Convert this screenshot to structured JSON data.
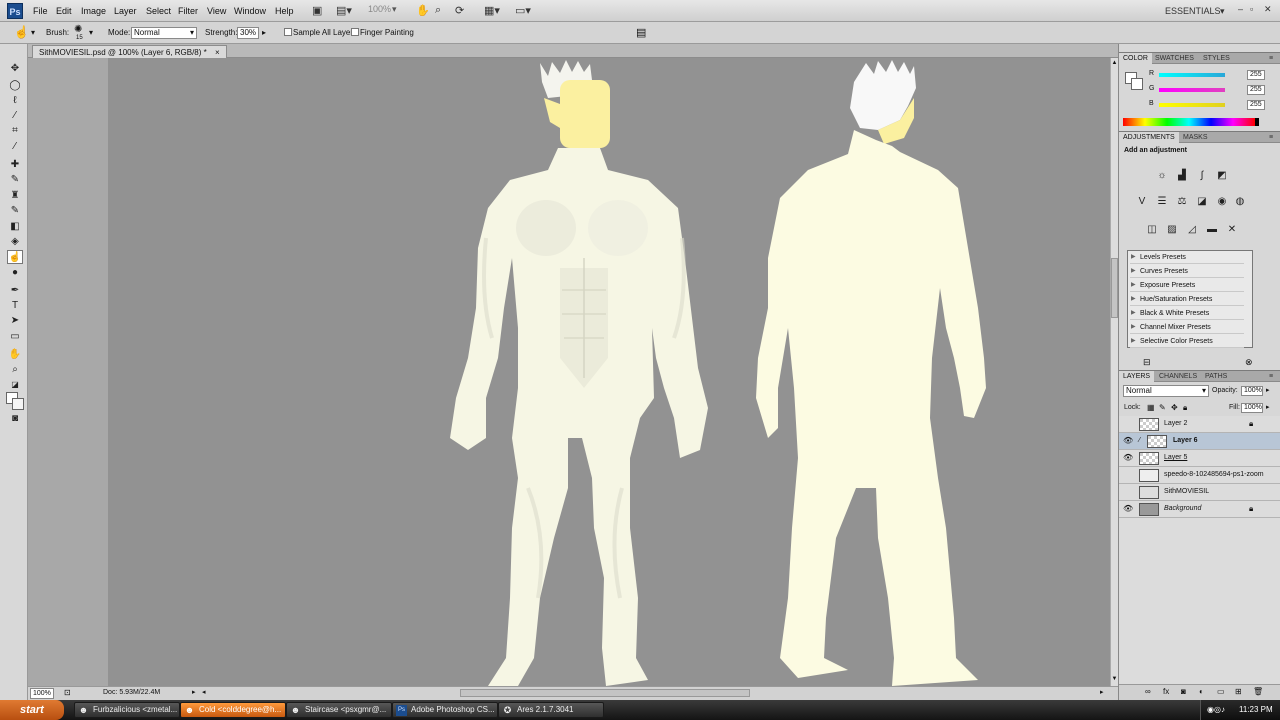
{
  "app": {
    "logo": "Ps",
    "workspace": "ESSENTIALS",
    "zoom_box": "100%"
  },
  "menu": [
    "File",
    "Edit",
    "Image",
    "Layer",
    "Select",
    "Filter",
    "View",
    "Window",
    "Help"
  ],
  "options": {
    "brush_label": "Brush:",
    "brush_size": "15",
    "mode_label": "Mode:",
    "mode_value": "Normal",
    "strength_label": "Strength:",
    "strength_value": "30%",
    "sample_all_layers": "Sample All Layers",
    "finger_painting": "Finger Painting"
  },
  "document": {
    "tab_title": "SithMOVIESIL.psd @ 100% (Layer 6, RGB/8) *"
  },
  "status": {
    "zoom": "100%",
    "doc_info": "Doc: 5.93M/22.4M"
  },
  "color_panel": {
    "tabs": [
      "COLOR",
      "SWATCHES",
      "STYLES"
    ],
    "channels": [
      {
        "label": "R",
        "value": "255",
        "color": "#2aa7d8"
      },
      {
        "label": "G",
        "value": "255",
        "color": "#e040c0"
      },
      {
        "label": "B",
        "value": "255",
        "color": "#e0d020"
      }
    ]
  },
  "adjustments": {
    "tabs": [
      "ADJUSTMENTS",
      "MASKS"
    ],
    "heading": "Add an adjustment",
    "presets": [
      "Levels Presets",
      "Curves Presets",
      "Exposure Presets",
      "Hue/Saturation Presets",
      "Black & White Presets",
      "Channel Mixer Presets",
      "Selective Color Presets"
    ]
  },
  "layers_panel": {
    "tabs": [
      "LAYERS",
      "CHANNELS",
      "PATHS"
    ],
    "blend_mode": "Normal",
    "opacity_label": "Opacity:",
    "opacity_value": "100%",
    "lock_label": "Lock:",
    "fill_label": "Fill:",
    "fill_value": "100%",
    "layers": [
      {
        "name": "Layer 2",
        "visible": false,
        "locked": true,
        "selected": false
      },
      {
        "name": "Layer 6",
        "visible": true,
        "locked": false,
        "selected": true
      },
      {
        "name": "Layer 5",
        "visible": true,
        "locked": false,
        "selected": false
      },
      {
        "name": "speedo-8-102485694-ps1-zoom",
        "visible": false,
        "locked": false,
        "selected": false
      },
      {
        "name": "SithMOVIESIL",
        "visible": false,
        "locked": false,
        "selected": false
      },
      {
        "name": "Background",
        "visible": true,
        "locked": true,
        "selected": false
      }
    ]
  },
  "taskbar": {
    "start": "start",
    "tasks": [
      {
        "label": "Furbzalicious <zmetal..."
      },
      {
        "label": "Cold <colddegree@h..."
      },
      {
        "label": "Staircase <psxgmr@..."
      },
      {
        "label": "Adobe Photoshop CS..."
      },
      {
        "label": "Ares 2.1.7.3041"
      }
    ],
    "clock": "11:23 PM"
  },
  "colors": {
    "canvas_bg": "#929292",
    "skin": "#f7f6e4",
    "hair_highlight": "#fbf0a0",
    "accent": "#1b4d8f"
  }
}
